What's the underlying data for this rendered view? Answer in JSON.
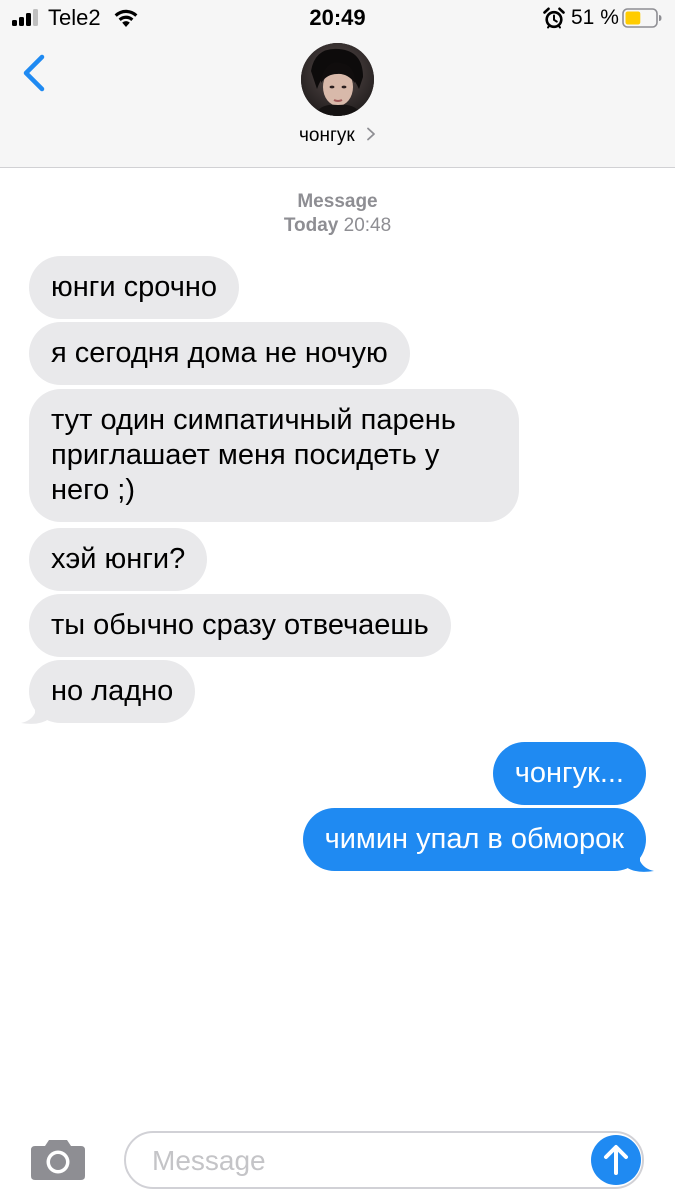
{
  "status_bar": {
    "carrier": "Tele2",
    "time": "20:49",
    "battery_percent": "51 %",
    "battery_level": 0.51,
    "battery_color": "#ffcc00",
    "signal_icon": "cellular-signal-icon",
    "wifi_icon": "wifi-icon",
    "alarm_icon": "alarm-clock-icon"
  },
  "nav": {
    "back_icon": "chevron-left-icon",
    "contact_name": "чонгук",
    "contact_chevron_icon": "chevron-right-icon",
    "accent_color": "#1f8af2"
  },
  "thread": {
    "service": "Message",
    "day": "Today",
    "time": "20:48",
    "messages": [
      {
        "direction": "incoming",
        "text": "юнги срочно"
      },
      {
        "direction": "incoming",
        "text": "я сегодня дома не ночую"
      },
      {
        "direction": "incoming",
        "text": "тут один симпатичный парень приглашает меня посидеть у него ;)"
      },
      {
        "direction": "incoming",
        "text": "хэй юнги?"
      },
      {
        "direction": "incoming",
        "text": "ты обычно сразу отвечаешь"
      },
      {
        "direction": "incoming",
        "text": "но ладно"
      },
      {
        "direction": "outgoing",
        "text": "чонгук..."
      },
      {
        "direction": "outgoing",
        "text": "чимин упал в обморок"
      }
    ]
  },
  "composer": {
    "camera_icon": "camera-icon",
    "placeholder": "Message",
    "value": "",
    "send_icon": "arrow-up-icon"
  }
}
